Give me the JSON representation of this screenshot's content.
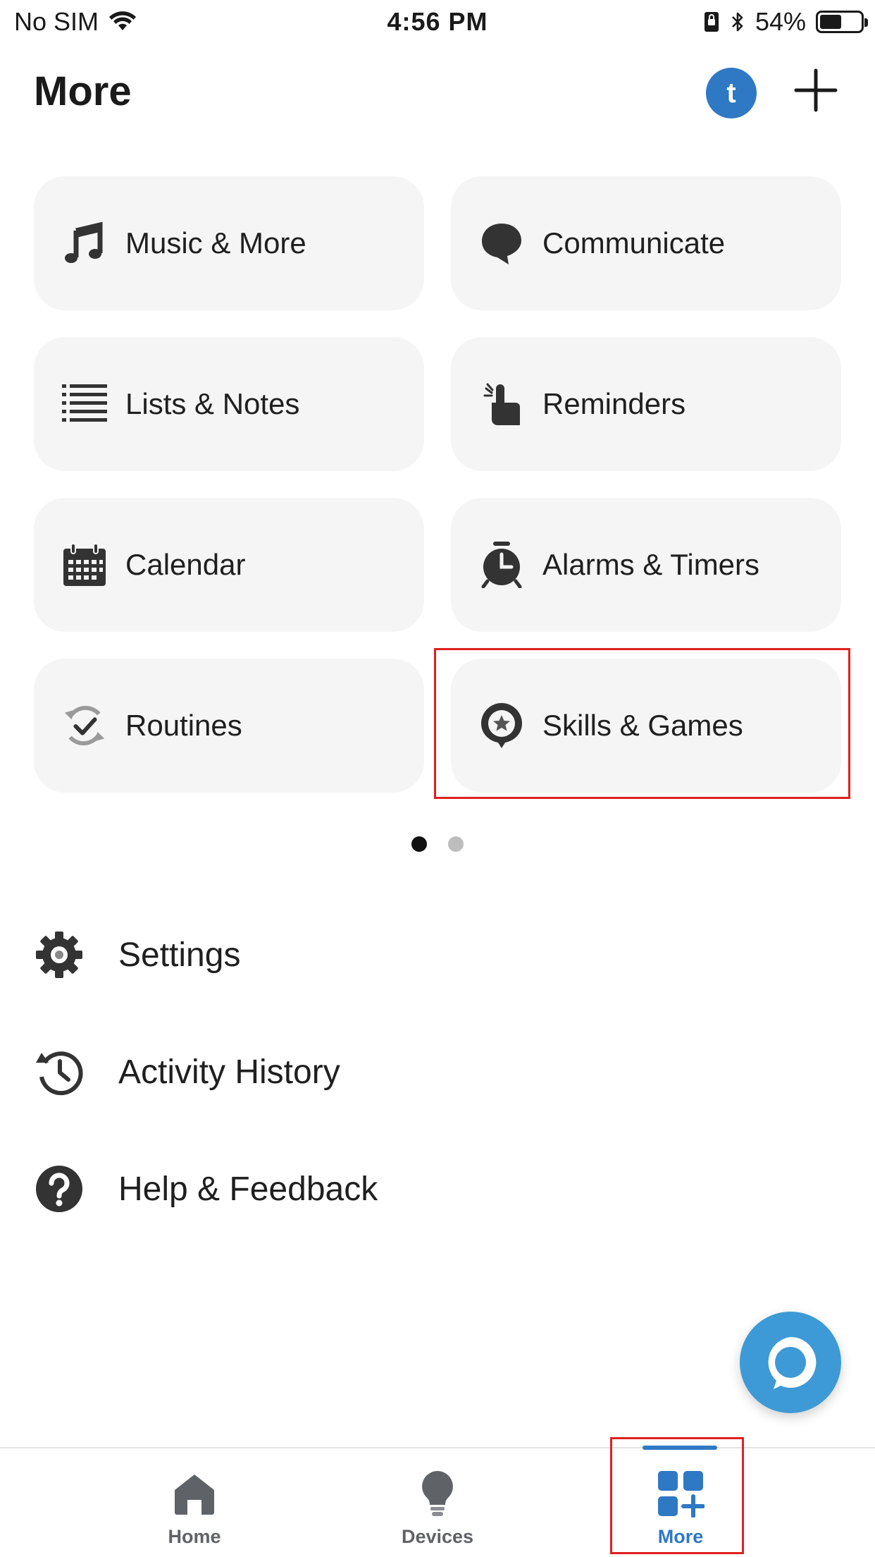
{
  "status_bar": {
    "carrier": "No SIM",
    "time": "4:56 PM",
    "battery_percent": "54%",
    "battery_level": 0.54
  },
  "header": {
    "title": "More",
    "avatar_initial": "t"
  },
  "tiles": [
    {
      "label": "Music & More",
      "icon": "music-note-icon"
    },
    {
      "label": "Communicate",
      "icon": "chat-bubble-icon"
    },
    {
      "label": "Lists & Notes",
      "icon": "list-icon"
    },
    {
      "label": "Reminders",
      "icon": "reminder-finger-icon"
    },
    {
      "label": "Calendar",
      "icon": "calendar-icon"
    },
    {
      "label": "Alarms & Timers",
      "icon": "alarm-clock-icon"
    },
    {
      "label": "Routines",
      "icon": "routines-check-icon"
    },
    {
      "label": "Skills & Games",
      "icon": "skills-star-icon"
    }
  ],
  "pager": {
    "pages": 2,
    "current": 1
  },
  "list": [
    {
      "label": "Settings",
      "icon": "gear-icon"
    },
    {
      "label": "Activity History",
      "icon": "history-icon"
    },
    {
      "label": "Help & Feedback",
      "icon": "help-icon"
    }
  ],
  "bottom_nav": {
    "items": [
      {
        "label": "Home",
        "icon": "home-icon"
      },
      {
        "label": "Devices",
        "icon": "lightbulb-icon"
      },
      {
        "label": "More",
        "icon": "more-grid-icon",
        "active": true
      }
    ]
  },
  "colors": {
    "accent": "#2f78c4",
    "alexa": "#3d9ad6",
    "tile_bg": "#f5f5f5",
    "highlight": "#e02020"
  }
}
